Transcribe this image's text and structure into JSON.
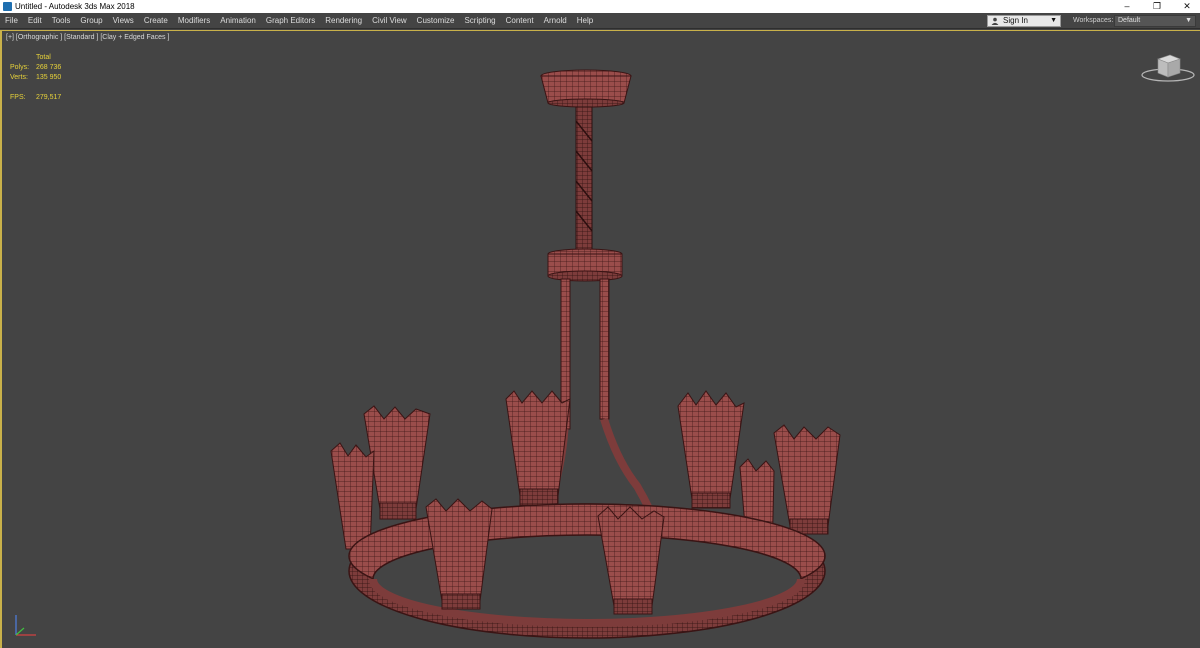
{
  "window": {
    "title": "Untitled - Autodesk 3ds Max 2018",
    "minimize_icon": "minimize-icon",
    "restore_icon": "restore-icon",
    "close_icon": "close-icon"
  },
  "menubar": {
    "items": [
      "File",
      "Edit",
      "Tools",
      "Group",
      "Views",
      "Create",
      "Modifiers",
      "Animation",
      "Graph Editors",
      "Rendering",
      "Civil View",
      "Customize",
      "Scripting",
      "Content",
      "Arnold",
      "Help"
    ],
    "sign_in": "Sign In",
    "workspaces_label": "Workspaces:",
    "workspace_value": "Default"
  },
  "viewport": {
    "label": "[+] [Orthographic ] [Standard ] [Clay + Edged Faces ]",
    "stats": {
      "header": "Total",
      "polys_label": "Polys:",
      "polys_value": "268 736",
      "verts_label": "Verts:",
      "verts_value": "135 950",
      "fps_label": "FPS:",
      "fps_value": "279,517"
    }
  },
  "colors": {
    "model_fill": "#9a4d4b",
    "model_edge": "#3a1414",
    "viewport_bg": "#444444",
    "stats_text": "#e7d23a",
    "active_border": "#c9b14a"
  }
}
